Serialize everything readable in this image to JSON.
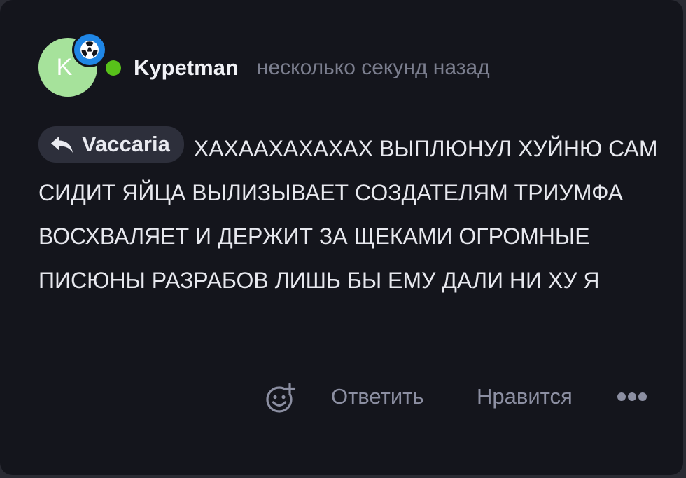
{
  "comment": {
    "author": {
      "initial": "K",
      "name": "Kypetman",
      "status": "online",
      "badge_icon": "radiation-icon"
    },
    "timestamp": "несколько секунд назад",
    "reply_to": {
      "name": "Vaccaria",
      "icon": "reply-arrow-icon"
    },
    "text": "ХАХААХАХАХАХ ВЫПЛЮНУЛ ХУЙНЮ САМ СИДИТ ЯЙЦА ВЫЛИЗЫВАЕТ СОЗДАТЕЛЯМ ТРИУМФА ВОСХВАЛЯЕТ И ДЕРЖИТ ЗА ЩЕКАМИ ОГРОМНЫЕ ПИСЮНЫ РАЗРАБОВ ЛИШЬ БЫ ЕМУ ДАЛИ НИ ХУ Я"
  },
  "actions": {
    "react_icon": "add-emoji-icon",
    "reply_label": "Ответить",
    "like_label": "Нравится",
    "more_icon": "more-dots-icon"
  },
  "colors": {
    "background": "#14151c",
    "avatar": "#a6e29b",
    "badge": "#1f86e6",
    "online": "#58c11a",
    "muted_text": "#8c8fa2"
  }
}
